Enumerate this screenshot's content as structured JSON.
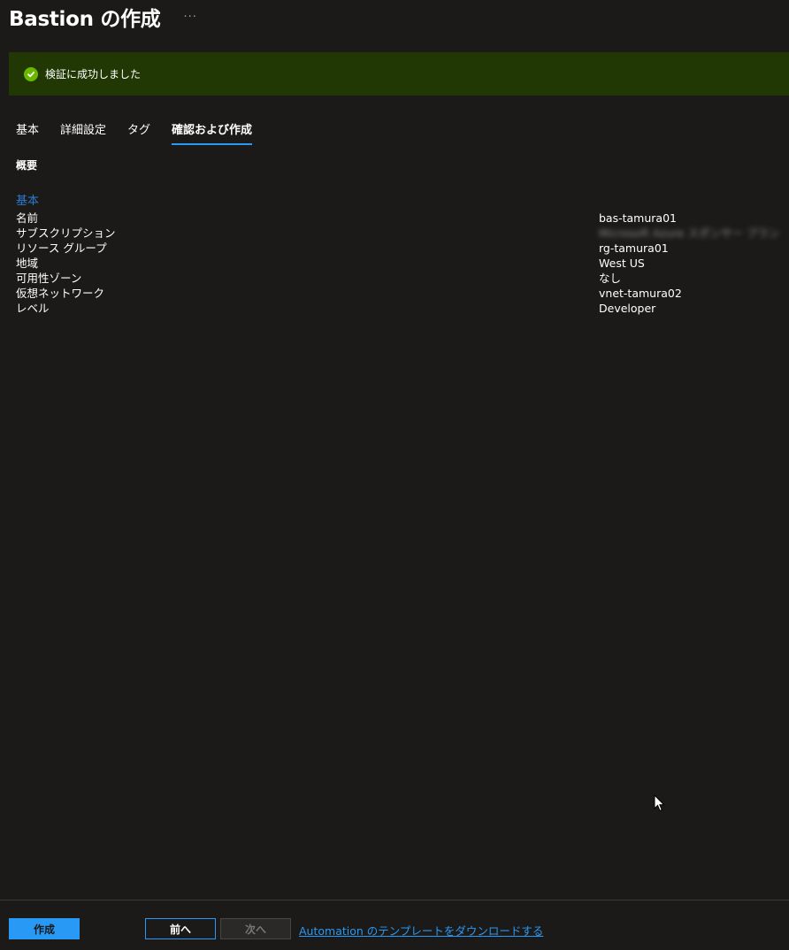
{
  "header": {
    "title": "Bastion の作成",
    "more_label": "···"
  },
  "banner": {
    "message": "検証に成功しました",
    "status_color": "#6bb700",
    "background_color": "#213804"
  },
  "tabs": [
    {
      "label": "基本",
      "active": false
    },
    {
      "label": "詳細設定",
      "active": false
    },
    {
      "label": "タグ",
      "active": false
    },
    {
      "label": "確認および作成",
      "active": true
    }
  ],
  "summary": {
    "heading": "概要",
    "group_heading": "基本",
    "rows": [
      {
        "label": "名前",
        "value": "bas-tamura01"
      },
      {
        "label": "サブスクリプション",
        "value": "Microsoft Azure スポンサー プラン",
        "redacted": true
      },
      {
        "label": "リソース グループ",
        "value": "rg-tamura01"
      },
      {
        "label": "地域",
        "value": "West US"
      },
      {
        "label": "可用性ゾーン",
        "value": "なし"
      },
      {
        "label": "仮想ネットワーク",
        "value": "vnet-tamura02"
      },
      {
        "label": "レベル",
        "value": "Developer"
      }
    ]
  },
  "footer": {
    "create_label": "作成",
    "prev_label": "前へ",
    "next_label": "次へ",
    "download_link": "Automation のテンプレートをダウンロードする"
  },
  "colors": {
    "accent": "#2899f5",
    "background": "#1b1a19",
    "group_heading": "#2b7bd1"
  }
}
